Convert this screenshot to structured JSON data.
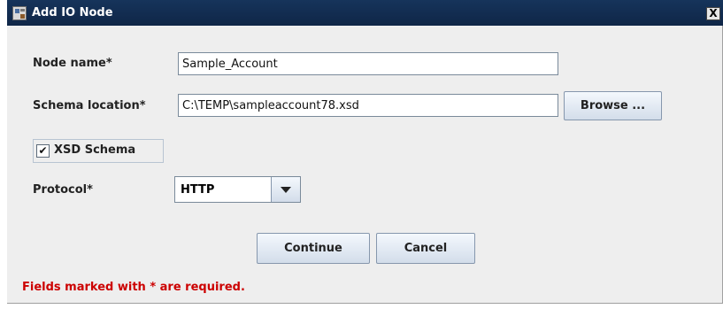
{
  "window": {
    "title": "Add IO Node",
    "close_label": "X"
  },
  "form": {
    "node_name_label": "Node name*",
    "node_name_value": "Sample_Account",
    "schema_location_label": "Schema location*",
    "schema_location_value": "C:\\TEMP\\sampleaccount78.xsd",
    "browse_label": "Browse ...",
    "xsd_schema_label": "XSD Schema",
    "xsd_schema_checked": true,
    "protocol_label": "Protocol*",
    "protocol_value": "HTTP"
  },
  "actions": {
    "continue_label": "Continue",
    "cancel_label": "Cancel"
  },
  "footer": {
    "required_note": "Fields marked with * are required."
  },
  "colors": {
    "titlebar": "#12305a",
    "dialog_bg": "#eeeeee",
    "required_text": "#cc0000"
  }
}
